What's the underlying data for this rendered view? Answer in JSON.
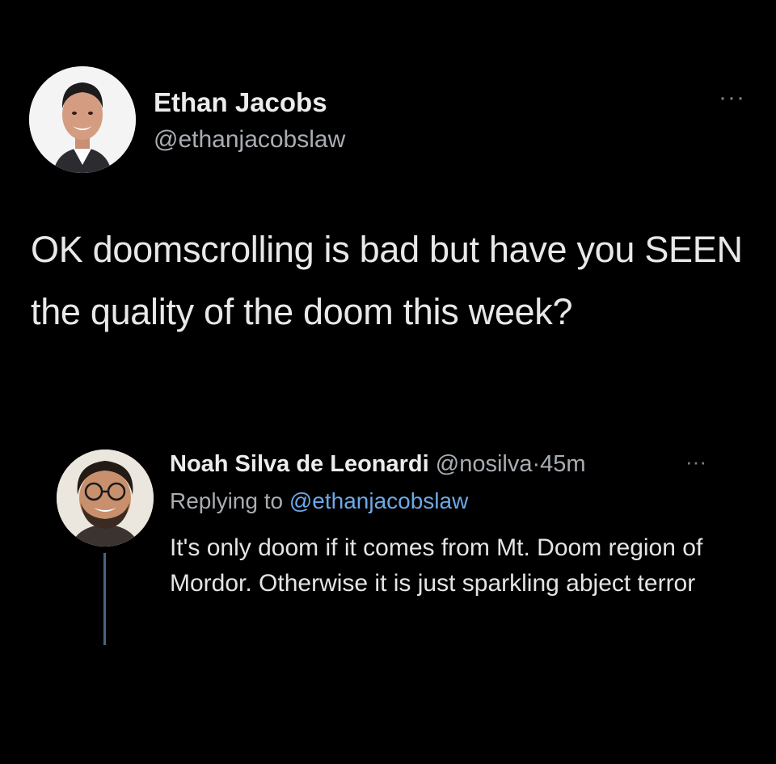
{
  "tweet": {
    "author_name": "Ethan Jacobs",
    "author_handle": "@ethanjacobslaw",
    "more_label": "···",
    "text": "OK doomscrolling is bad but have you SEEN the quality of the doom this week?"
  },
  "reply": {
    "author_name": "Noah Silva de Leonardi",
    "author_handle": "@nosilva",
    "separator": "·",
    "time": "45m",
    "more_label": "···",
    "replying_prefix": "Replying to",
    "replying_handle": "@ethanjacobslaw",
    "text": "It's only doom if it comes from Mt. Doom region of Mordor. Otherwise it is just sparkling abject terror"
  },
  "colors": {
    "background": "#000000",
    "link": "#6ea8e6",
    "thread_line": "#4a6380"
  }
}
